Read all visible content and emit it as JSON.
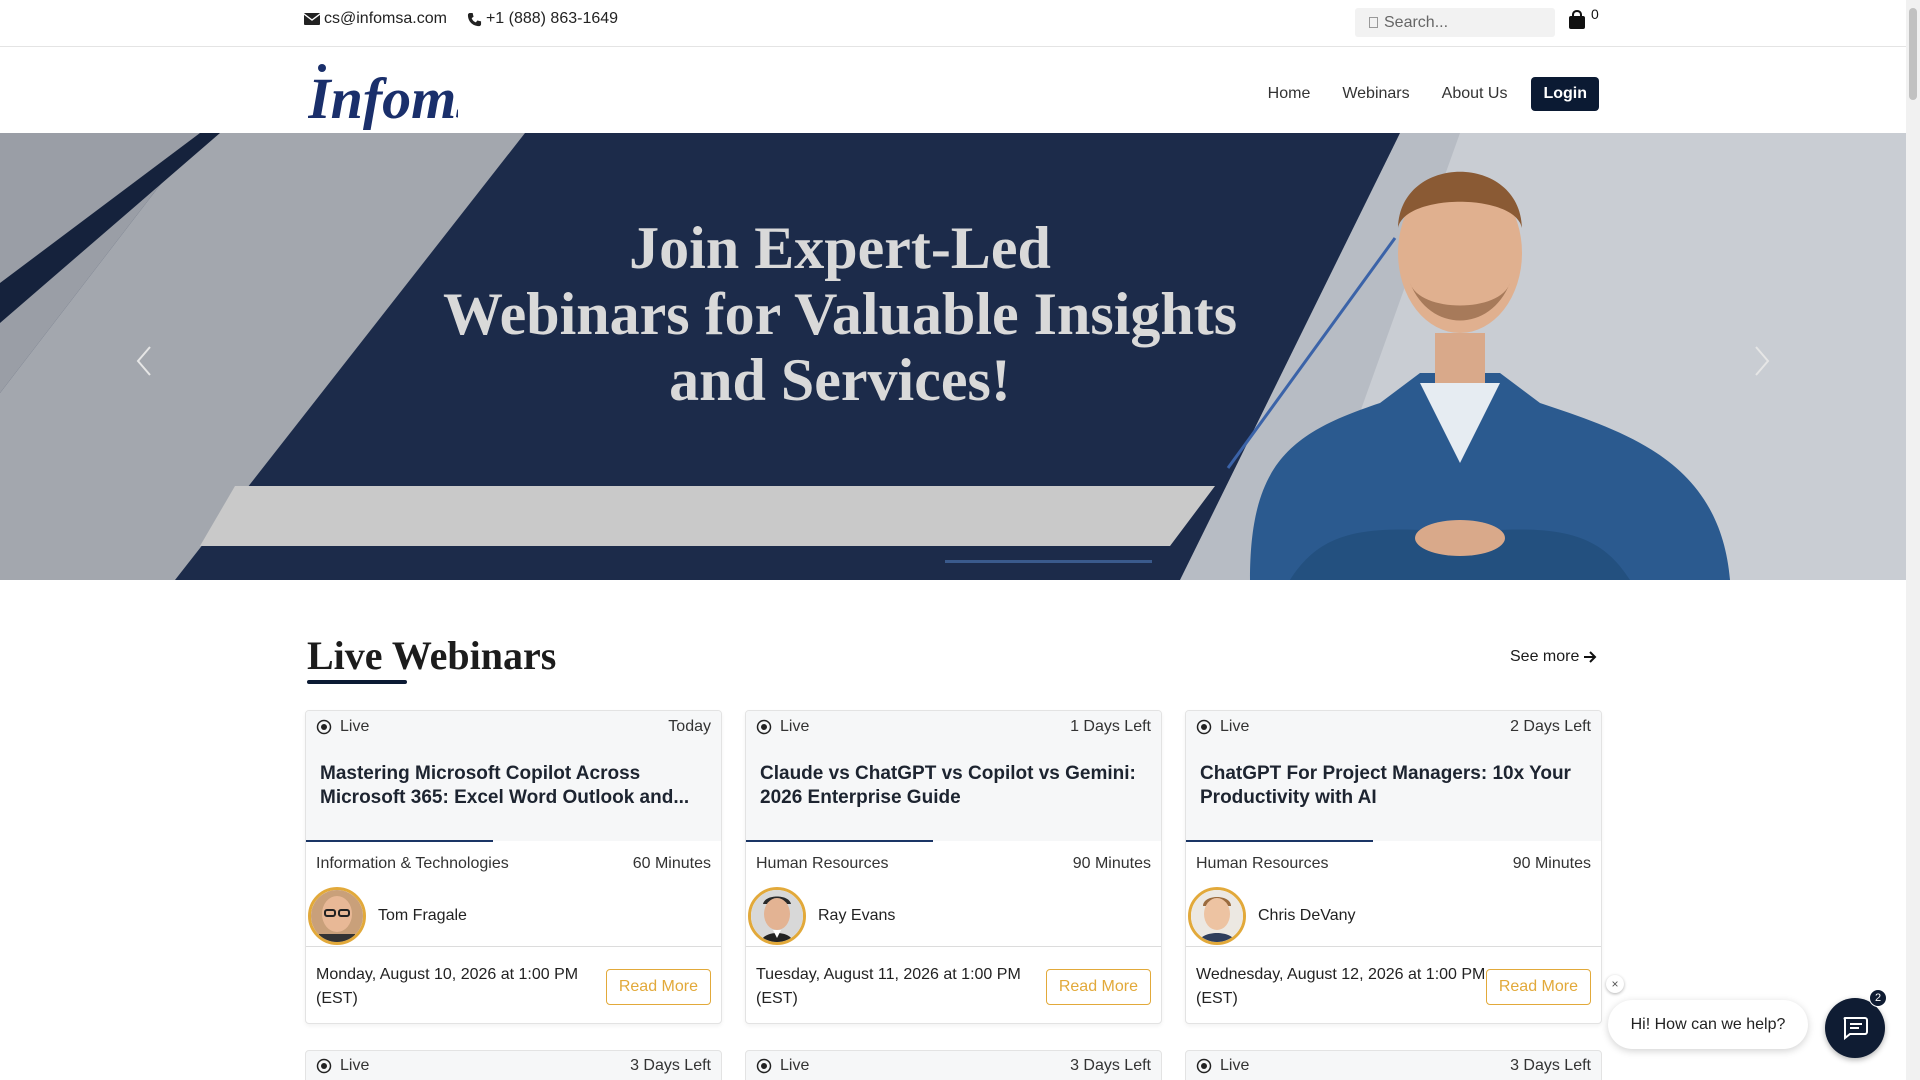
{
  "topbar": {
    "email": "cs@infomsa.com",
    "phone": "+1 (888) 863-1649",
    "search_placeholder": "Search...",
    "cart_count": "0"
  },
  "nav": {
    "logo": "Infomsa",
    "items": [
      {
        "label": "Home"
      },
      {
        "label": "Webinars"
      },
      {
        "label": "About Us"
      }
    ],
    "login_label": "Login"
  },
  "hero": {
    "title_line1": "Join Expert-Led",
    "title_line2": "Webinars for Valuable Insights",
    "title_line3": "and Services!"
  },
  "section": {
    "title": "Live Webinars",
    "see_more": "See more"
  },
  "cards": [
    {
      "status": "Live",
      "days": "Today",
      "title": "Mastering Microsoft Copilot Across Microsoft 365: Excel Word Outlook and...",
      "category": "Information & Technologies",
      "duration": "60 Minutes",
      "speaker": "Tom Fragale",
      "date": "Monday, August 10, 2026 at 1:00 PM (EST)",
      "cta": "Read More"
    },
    {
      "status": "Live",
      "days": "1 Days Left",
      "title": "Claude vs ChatGPT vs Copilot vs Gemini: 2026 Enterprise Guide",
      "category": "Human Resources",
      "duration": "90 Minutes",
      "speaker": "Ray Evans",
      "date": "Tuesday, August 11, 2026 at 1:00 PM (EST)",
      "cta": "Read More"
    },
    {
      "status": "Live",
      "days": "2 Days Left",
      "title": "ChatGPT For Project Managers: 10x Your Productivity with AI",
      "category": "Human Resources",
      "duration": "90 Minutes",
      "speaker": "Chris DeVany",
      "date": "Wednesday, August 12, 2026 at 1:00 PM (EST)",
      "cta": "Read More"
    }
  ],
  "cards_row2": [
    {
      "status": "Live",
      "days": "3 Days Left"
    },
    {
      "status": "Live",
      "days": "3 Days Left"
    },
    {
      "status": "Live",
      "days": "3 Days Left"
    }
  ],
  "chat": {
    "greeting": "Hi! How can we help?",
    "badge": "2",
    "close": "×"
  },
  "colors": {
    "navy": "#0b1a33",
    "accent_gold": "#e2a93a",
    "hero_bg": "#1c2b4a"
  }
}
